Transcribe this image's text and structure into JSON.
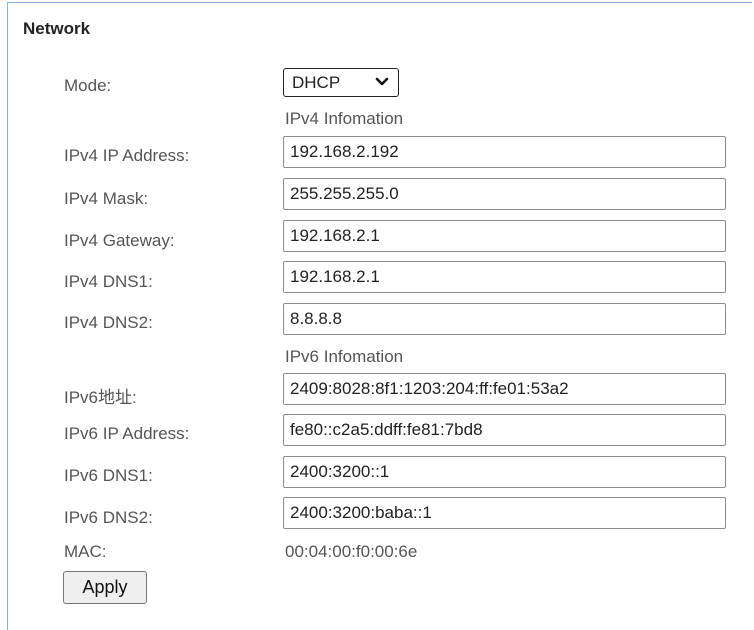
{
  "panel": {
    "title": "Network"
  },
  "mode": {
    "label": "Mode:",
    "value": "DHCP"
  },
  "ipv4": {
    "heading": "IPv4 Infomation",
    "address": {
      "label": "IPv4 IP Address:",
      "value": "192.168.2.192"
    },
    "mask": {
      "label": "IPv4 Mask:",
      "value": "255.255.255.0"
    },
    "gateway": {
      "label": "IPv4 Gateway:",
      "value": "192.168.2.1"
    },
    "dns1": {
      "label": "IPv4 DNS1:",
      "value": "192.168.2.1"
    },
    "dns2": {
      "label": "IPv4 DNS2:",
      "value": "8.8.8.8"
    }
  },
  "ipv6": {
    "heading": "IPv6 Infomation",
    "global": {
      "label": "IPv6地址:",
      "value": "2409:8028:8f1:1203:204:ff:fe01:53a2"
    },
    "address": {
      "label": "IPv6 IP Address:",
      "value": "fe80::c2a5:ddff:fe81:7bd8"
    },
    "dns1": {
      "label": "IPv6 DNS1:",
      "value": "2400:3200::1"
    },
    "dns2": {
      "label": "IPv6 DNS2:",
      "value": "2400:3200:baba::1"
    }
  },
  "mac": {
    "label": "MAC:",
    "value": "00:04:00:f0:00:6e"
  },
  "actions": {
    "apply_label": "Apply"
  }
}
